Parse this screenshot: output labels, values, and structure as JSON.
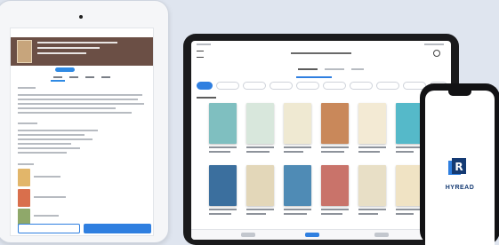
{
  "phone": {
    "brand_text": "HYREAD",
    "logo_letter": "R"
  },
  "colors": {
    "accent": "#2f7fe0",
    "background": "#dfe5ef",
    "brand": "#143a73"
  },
  "icons": {
    "left_tablet_camera": "camera-dot",
    "phone_logo": "hyread-logo-icon"
  }
}
